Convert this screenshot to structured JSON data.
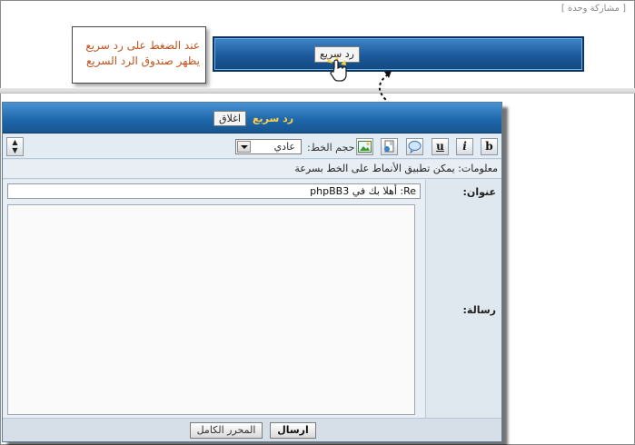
{
  "page": {
    "single_post_label": "[ مشاركة وحدة ]"
  },
  "callout": {
    "line1": "عند الضغط على رد سريع",
    "line2": "يظهر صندوق الرد السريع"
  },
  "top_bar": {
    "quick_reply_button": "رد سريع"
  },
  "quick_reply_panel": {
    "title": "رد سريع",
    "close_button": "اغلاق",
    "toolbar": {
      "bold": "b",
      "italic": "i",
      "underline": "u",
      "font_size_label": "حجم الخط:",
      "font_size_value": "عادي",
      "expand_icon": "⇕"
    },
    "info_text": "معلومات: يمكن تطبيق الأنماط على الخط بسرعة",
    "subject_label": "عنوان:",
    "subject_value": "Re: أهلا بك في phpBB3",
    "message_label": "رسالة:",
    "message_value": "",
    "send_button": "ارسال",
    "full_editor_button": "المحرر الكامل"
  },
  "colors": {
    "header_blue": "#1f68ad",
    "title_gold": "#ffd24a",
    "callout_text": "#c0531b"
  }
}
